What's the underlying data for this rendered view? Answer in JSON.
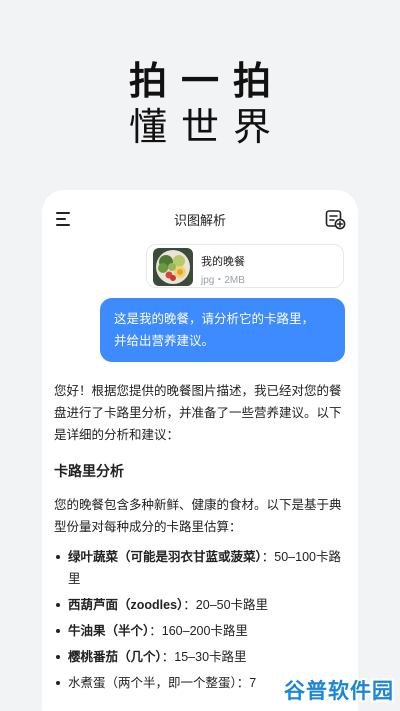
{
  "hero": {
    "line1": "拍一拍",
    "line2": "懂世界"
  },
  "app": {
    "title": "识图解析",
    "menu_icon": "menu-icon",
    "new_chat_icon": "new-chat-icon"
  },
  "attachment": {
    "name": "我的晚餐",
    "meta": "jpg・2MB"
  },
  "user_message": {
    "line1": "这是我的晚餐，请分析它的卡路里，",
    "line2": "并给出营养建议。"
  },
  "answer": {
    "intro": "您好！根据您提供的晚餐图片描述，我已经对您的餐盘进行了卡路里分析，并准备了一些营养建议。以下是详细的分析和建议：",
    "heading": "卡路里分析",
    "paragraph": "您的晚餐包含多种新鲜、健康的食材。以下是基于典型份量对每种成分的卡路里估算：",
    "items": [
      {
        "name": "绿叶蔬菜（可能是羽衣甘蓝或菠菜）",
        "value": "：50–100卡路里"
      },
      {
        "name": "西葫芦面（zoodles）",
        "value": "：20–50卡路里"
      },
      {
        "name": "牛油果（半个）",
        "value": "：160–200卡路里"
      },
      {
        "name": "樱桃番茄（几个）",
        "value": "：15–30卡路里"
      },
      {
        "name": "",
        "value": "水煮蛋（两个半，即一个整蛋）：7"
      }
    ]
  },
  "watermark": {
    "text": "谷普软件园"
  },
  "colors": {
    "accent": "#3d8bff",
    "background": "#f2f3f5",
    "watermark": "#1b86d6"
  }
}
